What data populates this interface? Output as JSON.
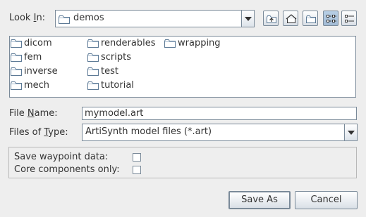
{
  "look_in": {
    "label_prefix": "Look ",
    "label_mnemonic": "I",
    "label_suffix": "n:",
    "selected": "demos",
    "toolbar_icons": [
      "up-folder-icon",
      "home-folder-icon",
      "new-folder-icon",
      "list-view-icon",
      "details-view-icon"
    ]
  },
  "files": [
    {
      "name": "dicom",
      "icon": "folder-icon"
    },
    {
      "name": "fem",
      "icon": "folder-icon"
    },
    {
      "name": "inverse",
      "icon": "folder-icon"
    },
    {
      "name": "mech",
      "icon": "folder-icon"
    },
    {
      "name": "renderables",
      "icon": "folder-icon"
    },
    {
      "name": "scripts",
      "icon": "folder-icon"
    },
    {
      "name": "test",
      "icon": "folder-icon"
    },
    {
      "name": "tutorial",
      "icon": "folder-icon"
    },
    {
      "name": "wrapping",
      "icon": "folder-icon"
    }
  ],
  "file_name": {
    "label_prefix": "File ",
    "label_mnemonic": "N",
    "label_suffix": "ame:",
    "value": "mymodel.art"
  },
  "file_type": {
    "label_prefix": "Files of ",
    "label_mnemonic": "T",
    "label_suffix": "ype:",
    "selected": "ArtiSynth model files (*.art)"
  },
  "options": {
    "save_waypoints": {
      "label": "Save waypoint data:",
      "checked": false
    },
    "core_only": {
      "label": "Core components only:",
      "checked": false
    }
  },
  "buttons": {
    "save": "Save As",
    "cancel": "Cancel"
  },
  "colors": {
    "background": "#eeeeee",
    "border": "#7a8a99",
    "text": "#333333",
    "folder_fill": "#ffffff",
    "folder_stroke": "#5d7a96"
  }
}
